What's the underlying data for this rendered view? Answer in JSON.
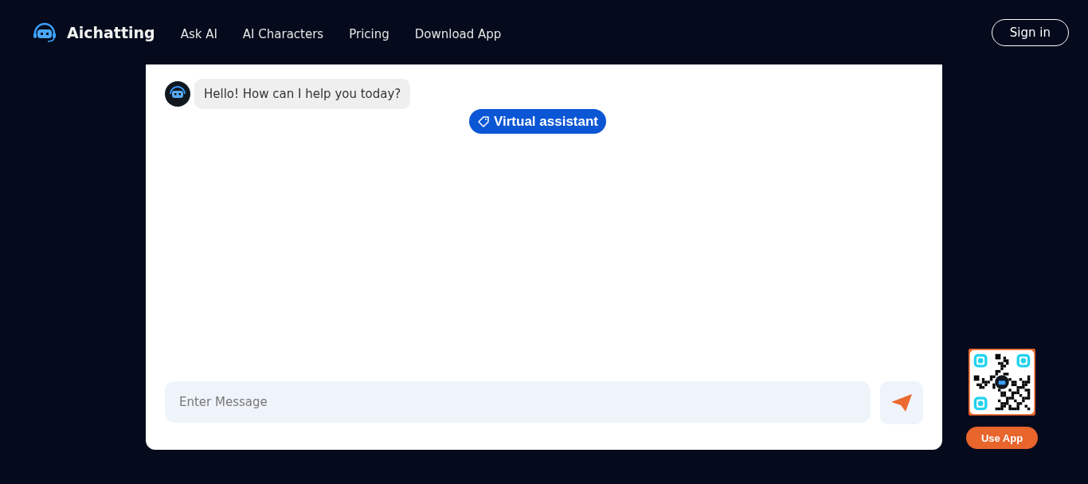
{
  "header": {
    "brand": "Aichatting",
    "nav": [
      {
        "label": "Ask AI"
      },
      {
        "label": "AI Characters"
      },
      {
        "label": "Pricing"
      },
      {
        "label": "Download App"
      }
    ],
    "sign_in": "Sign in"
  },
  "chat": {
    "messages": [
      {
        "text": "Hello! How can I help you today?"
      }
    ],
    "tag": "Virtual assistant",
    "input": {
      "placeholder": "Enter Message"
    }
  },
  "app_widget": {
    "button": "Use App"
  }
}
